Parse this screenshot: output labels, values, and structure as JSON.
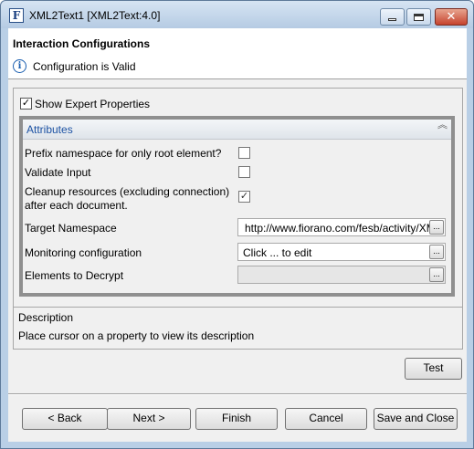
{
  "window": {
    "app_icon": "F",
    "title": "XML2Text1 [XML2Text:4.0]",
    "minimize_icon": "minimize-icon",
    "maximize_icon": "maximize-icon",
    "close_glyph": "✕"
  },
  "header": {
    "title": "Interaction Configurations",
    "status_icon": "i",
    "status": "Configuration is Valid"
  },
  "expert": {
    "label": "Show Expert Properties",
    "checked": true,
    "check_glyph": "✓"
  },
  "attributes": {
    "title": "Attributes",
    "collapse_glyph": "︽",
    "properties": [
      {
        "label": "Prefix namespace for only root element?",
        "type": "checkbox",
        "checked": false
      },
      {
        "label": "Validate Input",
        "type": "checkbox",
        "checked": false
      },
      {
        "label_lines": [
          "Cleanup resources (excluding connection)",
          "after each document."
        ],
        "type": "checkbox",
        "checked": true,
        "check_glyph": "✓"
      },
      {
        "label": "Target Namespace",
        "type": "text",
        "value": "http://www.fiorano.com/fesb/activity/XM",
        "button": "..."
      },
      {
        "label": "Monitoring configuration",
        "type": "text",
        "value": "Click ... to edit",
        "button": "..."
      },
      {
        "label": "Elements to Decrypt",
        "type": "text",
        "value": "",
        "button": "..."
      }
    ]
  },
  "description": {
    "title": "Description",
    "text": "Place cursor on a property to view its description"
  },
  "buttons": {
    "test": "Test",
    "back": "< Back",
    "next": "Next >",
    "finish": "Finish",
    "cancel": "Cancel",
    "save_close": "Save and Close"
  }
}
